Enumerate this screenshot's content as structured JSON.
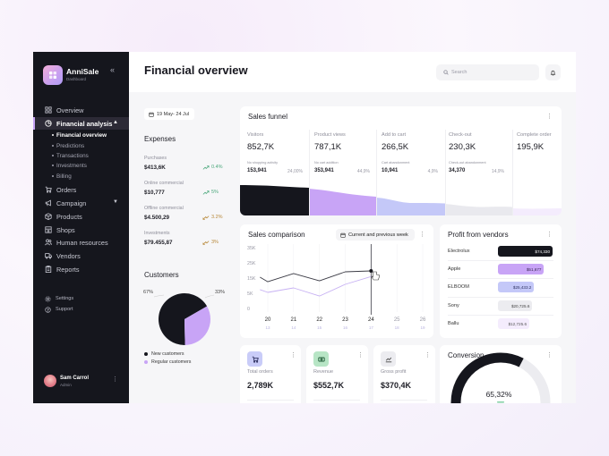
{
  "app": {
    "name": "AnniSale",
    "subtitle": "Dashboard",
    "collapse_glyph": "«"
  },
  "sidebar": {
    "items": [
      {
        "label": "Overview",
        "icon": "grid-icon"
      },
      {
        "label": "Financial analysis",
        "icon": "pie-chart-icon",
        "active": true,
        "expanded": true
      },
      {
        "label": "Orders",
        "icon": "cart-icon"
      },
      {
        "label": "Campaign",
        "icon": "megaphone-icon",
        "has_submenu": true
      },
      {
        "label": "Products",
        "icon": "box-icon"
      },
      {
        "label": "Shops",
        "icon": "store-icon"
      },
      {
        "label": "Human resources",
        "icon": "users-icon"
      },
      {
        "label": "Vendors",
        "icon": "truck-icon"
      },
      {
        "label": "Reports",
        "icon": "clipboard-icon"
      }
    ],
    "subitems": [
      {
        "label": "Financial overview",
        "active": true
      },
      {
        "label": "Predictions"
      },
      {
        "label": "Transactions"
      },
      {
        "label": "Investments"
      },
      {
        "label": "Billing"
      }
    ],
    "footer": [
      {
        "label": "Settings",
        "icon": "gear-icon"
      },
      {
        "label": "Support",
        "icon": "help-circle-icon"
      }
    ],
    "user": {
      "name": "Sam Carrol",
      "role": "Admin"
    },
    "chevron_up": "▲",
    "chevron_down": "▼",
    "menu_glyph": "⋮"
  },
  "header": {
    "title": "Financial overview",
    "search_placeholder": "Search"
  },
  "filters": {
    "date_range": "19 May- 24 Jul"
  },
  "expenses": {
    "title": "Expenses",
    "items": [
      {
        "label": "Purchases",
        "value": "$413,6K",
        "change": "0.4%",
        "trend": "up"
      },
      {
        "label": "Online commercial",
        "value": "$10,777",
        "change": "5%",
        "trend": "up"
      },
      {
        "label": "Offline commercial",
        "value": "$4.500,29",
        "change": "3.2%",
        "trend": "down"
      },
      {
        "label": "Investments",
        "value": "$79.455,87",
        "change": "3%",
        "trend": "down"
      }
    ]
  },
  "sales_funnel": {
    "title": "Sales funnel",
    "stages": [
      {
        "label": "Visitors",
        "value": "852,7K",
        "sub_label": "No shopping activity",
        "sub_value": "153,941",
        "sub_percent": "24,00%",
        "color": "#15161d"
      },
      {
        "label": "Product views",
        "value": "787,1K",
        "sub_label": "No cart addition",
        "sub_value": "353,941",
        "sub_percent": "44,9%",
        "color": "#c8a4f6"
      },
      {
        "label": "Add to cart",
        "value": "266,5K",
        "sub_label": "Cart abandonment",
        "sub_value": "10,941",
        "sub_percent": "4,9%",
        "color": "#c4c8f8"
      },
      {
        "label": "Check-out",
        "value": "230,3K",
        "sub_label": "Check-out abandonment",
        "sub_value": "34,370",
        "sub_percent": "14,9%",
        "color": "#e9e9ee"
      },
      {
        "label": "Complete order",
        "value": "195,9K",
        "color": "#f4ecfd"
      }
    ]
  },
  "sales_comparison": {
    "title": "Sales comparison",
    "period_selector": "Current and previous week"
  },
  "vendors": {
    "title": "Profit from vendors",
    "items": [
      {
        "name": "Electrolux",
        "value": 74330,
        "label": "$74,330",
        "color": "#15161d",
        "text_color": "#ffffff"
      },
      {
        "name": "Apple",
        "value": 51677,
        "label": "$51,677",
        "color": "#c8a4f6",
        "text_color": "#3a2a55"
      },
      {
        "name": "ELBOOM",
        "value": 25433.2,
        "label": "$25,433.2",
        "color": "#c4c8f8",
        "text_color": "#2e3260"
      },
      {
        "name": "Sony",
        "value": 20725.6,
        "label": "$20,725.6",
        "color": "#ececf0",
        "text_color": "#444444"
      },
      {
        "name": "Ballu",
        "value": 12725.6,
        "label": "$12,725.6",
        "color": "#f4ecfd",
        "text_color": "#555555"
      }
    ]
  },
  "kpis": [
    {
      "label": "Total orders",
      "value": "2,789K",
      "icon": "cart-icon",
      "color": "#c9ccf8"
    },
    {
      "label": "Revenue",
      "value": "$552,7K",
      "icon": "banknote-icon",
      "color": "#b7e5c5"
    },
    {
      "label": "Gross profit",
      "value": "$370,4K",
      "icon": "chart-line-icon",
      "color": "#ececf0"
    }
  ],
  "conversion": {
    "title": "Conversion",
    "value_label": "65,32%",
    "fraction": 0.6532,
    "fill_color": "#15161d",
    "track_color": "#ececf0"
  },
  "chart_data": [
    {
      "type": "line",
      "title": "Sales comparison",
      "legend": "Current and previous week",
      "x_ticks": [
        "20",
        "21",
        "22",
        "23",
        "24",
        "25",
        "26"
      ],
      "x_secondary_ticks": [
        "13",
        "14",
        "15",
        "16",
        "17",
        "18",
        "19"
      ],
      "x_range": [
        20,
        26
      ],
      "y_ticks": [
        {
          "label": "0",
          "value": 0
        },
        {
          "label": "5K",
          "value": 5000
        },
        {
          "label": "15K",
          "value": 15000
        },
        {
          "label": "25K",
          "value": 25000
        },
        {
          "label": "35K",
          "value": 35000
        }
      ],
      "highlight_x": 24,
      "series": [
        {
          "name": "Current week",
          "color": "#3b3b45",
          "x": [
            19.7,
            20,
            21,
            22,
            23,
            24
          ],
          "y": [
            15600,
            12600,
            18000,
            13200,
            19100,
            19700
          ]
        },
        {
          "name": "Previous week",
          "color": "#c7b1f3",
          "x": [
            19.7,
            20,
            21,
            22,
            23,
            24
          ],
          "y": [
            7400,
            5600,
            8500,
            4100,
            10900,
            16000
          ]
        }
      ]
    },
    {
      "type": "pie",
      "title": "Customers",
      "slices": [
        {
          "label": "New customers",
          "value": 67,
          "display": "67%",
          "color": "#15161d"
        },
        {
          "label": "Regular customers",
          "value": 33,
          "display": "33%",
          "color": "#c8a4f6"
        }
      ]
    }
  ]
}
